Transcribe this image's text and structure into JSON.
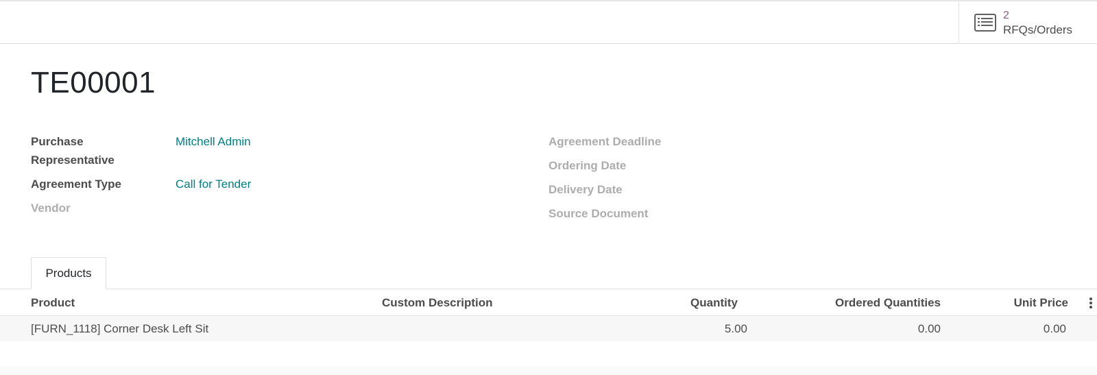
{
  "smart_button": {
    "count": "2",
    "label": "RFQs/Orders",
    "icon": "list-icon"
  },
  "record": {
    "title": "TE00001"
  },
  "fields_left": [
    {
      "label_line1": "Purchase",
      "label_line2": "Representative",
      "value": "Mitchell Admin"
    },
    {
      "label": "Agreement Type",
      "value": "Call for Tender"
    },
    {
      "label": "Vendor",
      "value": ""
    }
  ],
  "fields_right": [
    {
      "label": "Agreement Deadline",
      "value": ""
    },
    {
      "label": "Ordering Date",
      "value": ""
    },
    {
      "label": "Delivery Date",
      "value": ""
    },
    {
      "label": "Source Document",
      "value": ""
    }
  ],
  "tabs": [
    {
      "label": "Products"
    }
  ],
  "table": {
    "columns": [
      "Product",
      "Custom Description",
      "Quantity",
      "Ordered Quantities",
      "Unit Price"
    ],
    "rows": [
      {
        "product": "[FURN_1118] Corner Desk Left Sit",
        "description": "",
        "quantity": "5.00",
        "ordered": "0.00",
        "unit_price": "0.00"
      }
    ]
  },
  "colors": {
    "link": "#017e84",
    "count": "#875a7b",
    "label": "#4c4c4c",
    "muted": "#adadad"
  }
}
